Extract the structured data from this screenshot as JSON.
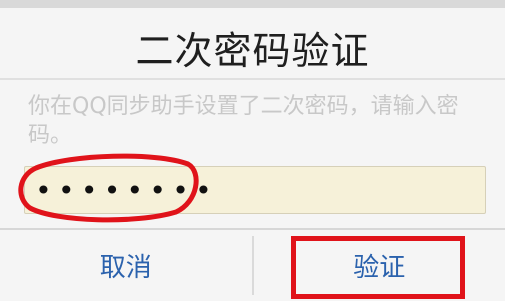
{
  "dialog": {
    "title": "二次密码验证",
    "message": "你在QQ同步助手设置了二次密码，请输入密码。",
    "password_value": "••••••••",
    "cancel_label": "取消",
    "confirm_label": "验证"
  },
  "colors": {
    "accent_blue": "#2b62ad",
    "annotation_red": "#e0131a",
    "input_background": "#f6f1d9"
  }
}
